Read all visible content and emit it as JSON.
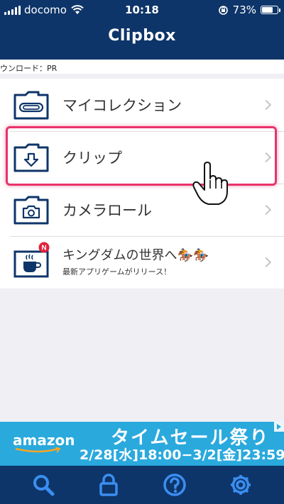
{
  "status_bar": {
    "carrier": "docomo",
    "time": "10:18",
    "battery_percent": "73%",
    "battery_level": 0.73
  },
  "header": {
    "title": "Clipbox"
  },
  "pr_strip": {
    "text": "ウンロード：PR"
  },
  "list": {
    "items": [
      {
        "label": "マイコレクション",
        "icon": "paperclip-folder-icon"
      },
      {
        "label": "クリップ",
        "icon": "download-folder-icon"
      },
      {
        "label": "カメラロール",
        "icon": "camera-folder-icon"
      },
      {
        "label": "キングダムの世界へ🏇🏇",
        "sublabel": "最新アプリゲームがリリース！",
        "icon": "coffee-cup-icon",
        "badge": "N"
      }
    ]
  },
  "ad": {
    "brand": "amazon",
    "title": "タイムセール祭り",
    "dates": "2/28[水]18:00−3/2[金]23:59"
  },
  "tabbar": {
    "tabs": [
      {
        "icon": "search-icon"
      },
      {
        "icon": "lock-icon"
      },
      {
        "icon": "help-icon"
      },
      {
        "icon": "gear-icon"
      }
    ]
  },
  "colors": {
    "header": "#0e3569",
    "accent_highlight": "#e8336a",
    "ad_background": "#2aa9dd",
    "badge": "#e0203a"
  }
}
